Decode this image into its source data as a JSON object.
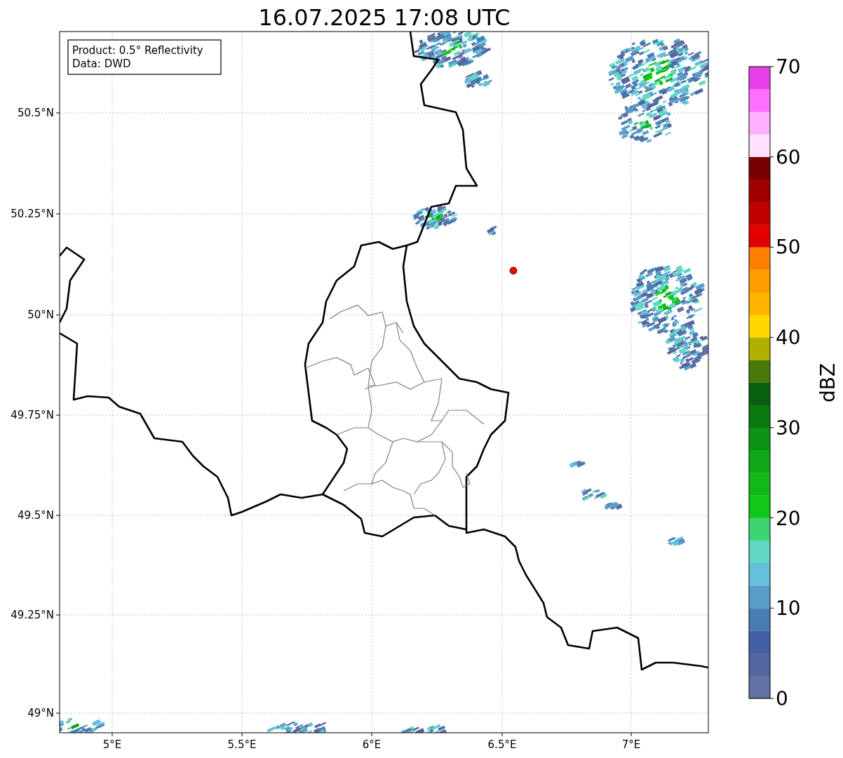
{
  "title": "16.07.2025 17:08 UTC",
  "map": {
    "legend": [
      "Product: 0.5° Reflectivity",
      "Data: DWD"
    ],
    "yticks": [
      "50.5°N",
      "50.25°N",
      "50°N",
      "49.75°N",
      "49.5°N",
      "49.25°N",
      "49°N"
    ],
    "xticks": [
      "5°E",
      "5.5°E",
      "6°E",
      "6.5°E",
      "7°E"
    ]
  },
  "colorbar": {
    "label": "dBZ",
    "ticks": [
      "70",
      "60",
      "50",
      "40",
      "30",
      "20",
      "10",
      "0"
    ],
    "bins": [
      {
        "color": "#6272a4"
      },
      {
        "color": "#5466a0"
      },
      {
        "color": "#4360a4"
      },
      {
        "color": "#4a7cb4"
      },
      {
        "color": "#5a9cc8"
      },
      {
        "color": "#66c0dc"
      },
      {
        "color": "#60d8c4"
      },
      {
        "color": "#3cd470"
      },
      {
        "color": "#10c818"
      },
      {
        "color": "#10b818"
      },
      {
        "color": "#10a818"
      },
      {
        "color": "#0c9414"
      },
      {
        "color": "#0a7a10"
      },
      {
        "color": "#086010"
      },
      {
        "color": "#4a7a0a"
      },
      {
        "color": "#b0b000"
      },
      {
        "color": "#ffd800"
      },
      {
        "color": "#ffb400"
      },
      {
        "color": "#ff9c00"
      },
      {
        "color": "#ff8000"
      },
      {
        "color": "#e00000"
      },
      {
        "color": "#c00000"
      },
      {
        "color": "#a00000"
      },
      {
        "color": "#780000"
      },
      {
        "color": "#ffe0ff"
      },
      {
        "color": "#ffb0ff"
      },
      {
        "color": "#ff70ff"
      },
      {
        "color": "#e840e8"
      }
    ]
  }
}
